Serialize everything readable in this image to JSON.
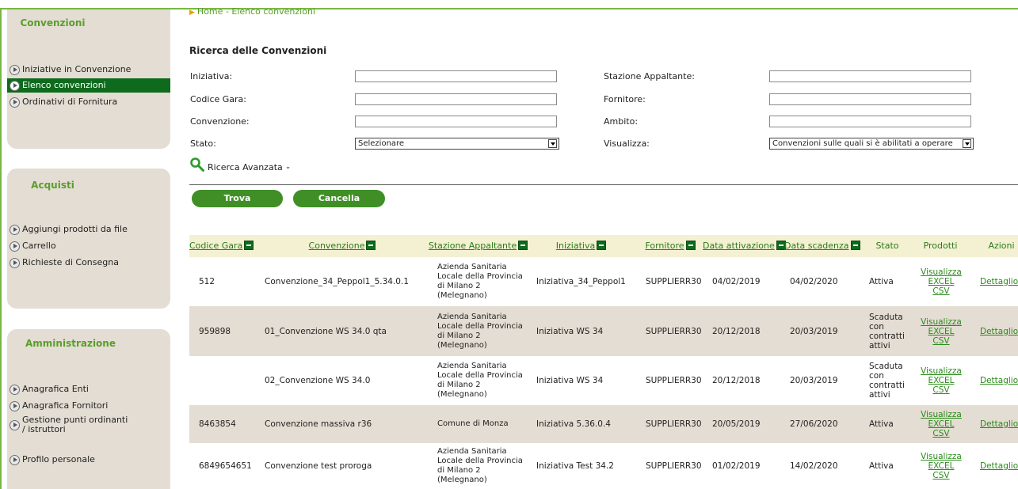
{
  "sidebar": {
    "convenzioni": {
      "title": "Convenzioni",
      "items": [
        {
          "label": "Iniziative in Convenzione"
        },
        {
          "label": "Elenco convenzioni",
          "active": true
        },
        {
          "label": "Ordinativi di Fornitura"
        }
      ]
    },
    "acquisti": {
      "title": "Acquisti",
      "items": [
        {
          "label": "Aggiungi prodotti da file"
        },
        {
          "label": "Carrello"
        },
        {
          "label": "Richieste di Consegna"
        }
      ]
    },
    "amministrazione": {
      "title": "Amministrazione",
      "items": [
        {
          "label": "Anagrafica Enti"
        },
        {
          "label": "Anagrafica Fornitori"
        },
        {
          "label": "Gestione punti ordinanti / istruttori"
        },
        {
          "label": "Profilo personale"
        }
      ]
    }
  },
  "breadcrumb": "Home - Elenco convenzioni",
  "search": {
    "title": "Ricerca delle Convenzioni",
    "iniziativa_label": "Iniziativa:",
    "codice_gara_label": "Codice Gara:",
    "convenzione_label": "Convenzione:",
    "stato_label": "Stato:",
    "stato_value": "Selezionare",
    "stazione_label": "Stazione Appaltante:",
    "fornitore_label": "Fornitore:",
    "ambito_label": "Ambito:",
    "visualizza_label": "Visualizza:",
    "visualizza_value": "Convenzioni sulle quali si è abilitati a operare",
    "advanced_label": "Ricerca Avanzata",
    "find_button": "Trova",
    "clear_button": "Cancella"
  },
  "table": {
    "headers": {
      "codice_gara": "Codice Gara",
      "convenzione": "Convenzione",
      "stazione": "Stazione Appaltante",
      "iniziativa": "Iniziativa",
      "fornitore": "Fornitore",
      "data_attivazione": "Data attivazione",
      "data_scadenza": "Data scadenza",
      "stato": "Stato",
      "prodotti": "Prodotti",
      "azioni": "Azioni"
    },
    "product_links": {
      "visualizza": "Visualizza",
      "excel": "EXCEL",
      "csv": "CSV"
    },
    "detail_link": "Dettaglio",
    "rows": [
      {
        "codice": "512",
        "convenzione": "Convenzione_34_Peppol1_5.34.0.1",
        "stazione": "Azienda Sanitaria Locale della Provincia di Milano 2 (Melegnano)",
        "iniziativa": "Iniziativa_34_Peppol1",
        "fornitore": "SUPPLIERR30",
        "attivazione": "04/02/2019",
        "scadenza": "04/02/2020",
        "stato": "Attiva"
      },
      {
        "codice": "959898",
        "convenzione": "01_Convenzione WS 34.0 qta",
        "stazione": "Azienda Sanitaria Locale della Provincia di Milano 2 (Melegnano)",
        "iniziativa": "Iniziativa WS 34",
        "fornitore": "SUPPLIERR30",
        "attivazione": "20/12/2018",
        "scadenza": "20/03/2019",
        "stato": "Scaduta con contratti attivi"
      },
      {
        "codice": "",
        "convenzione": "02_Convenzione WS 34.0",
        "stazione": "Azienda Sanitaria Locale della Provincia di Milano 2 (Melegnano)",
        "iniziativa": "Iniziativa WS 34",
        "fornitore": "SUPPLIERR30",
        "attivazione": "20/12/2018",
        "scadenza": "20/03/2019",
        "stato": "Scaduta con contratti attivi"
      },
      {
        "codice": "8463854",
        "convenzione": "Convenzione massiva r36",
        "stazione": "Comune di Monza",
        "iniziativa": "Iniziativa 5.36.0.4",
        "fornitore": "SUPPLIERR30",
        "attivazione": "20/05/2019",
        "scadenza": "27/06/2020",
        "stato": "Attiva"
      },
      {
        "codice": "6849654651",
        "convenzione": "Convenzione test proroga",
        "stazione": "Azienda Sanitaria Locale della Provincia di Milano 2 (Melegnano)",
        "iniziativa": "Iniziativa Test 34.2",
        "fornitore": "SUPPLIERR30",
        "attivazione": "01/02/2019",
        "scadenza": "14/02/2020",
        "stato": "Attiva"
      }
    ]
  }
}
